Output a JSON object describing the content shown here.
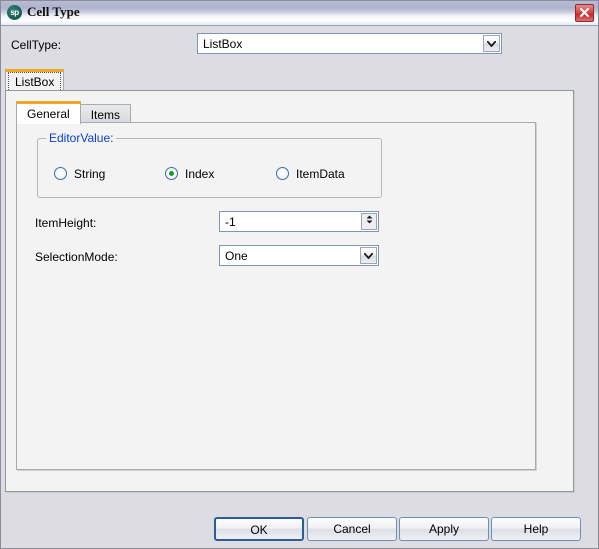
{
  "window": {
    "title": "Cell Type",
    "icon": "sp",
    "close_label": "close-icon"
  },
  "celltype": {
    "label": "CellType:",
    "value": "ListBox",
    "options": [
      "ListBox"
    ]
  },
  "outer_tabs": [
    {
      "label": "ListBox",
      "active": true
    }
  ],
  "inner_tabs": [
    {
      "label": "General",
      "active": true
    },
    {
      "label": "Items",
      "active": false
    }
  ],
  "editor_value": {
    "group_label": "EditorValue:",
    "options": [
      {
        "label": "String",
        "checked": false
      },
      {
        "label": "Index",
        "checked": true
      },
      {
        "label": "ItemData",
        "checked": false
      }
    ]
  },
  "item_height": {
    "label": "ItemHeight:",
    "value": "-1"
  },
  "selection_mode": {
    "label": "SelectionMode:",
    "value": "One",
    "options": [
      "One"
    ]
  },
  "buttons": {
    "ok": "OK",
    "cancel": "Cancel",
    "apply": "Apply",
    "help": "Help"
  },
  "colors": {
    "accent_orange": "#f0a723",
    "group_label_blue": "#0b3fd4",
    "radio_green": "#1f9a23",
    "close_red": "#c52b2b",
    "icon_teal": "#1d6159"
  }
}
